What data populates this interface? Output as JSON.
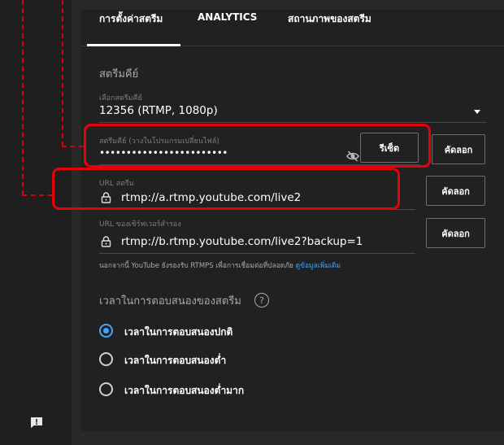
{
  "colors": {
    "accent": "#3ea6ff",
    "highlight": "#e8000b",
    "background": "#212121"
  },
  "tabs": [
    {
      "label": "การตั้งค่าสตรีม",
      "active": true
    },
    {
      "label": "ANALYTICS",
      "active": false
    },
    {
      "label": "สถานภาพของสตรีม",
      "active": false
    }
  ],
  "stream_key_section": {
    "title": "สตรีมคีย์",
    "select_label": "เลือกสตรีมคีย์",
    "select_value": "12356 (RTMP, 1080p)",
    "key_label": "สตรีมคีย์ (วางในโปรแกรมเปลี่ยนไฟล์)",
    "key_value": "••••••••••••••••••••••••",
    "reset_button": "รีเซ็ต",
    "copy_button": "คัดลอก"
  },
  "stream_url": {
    "label": "URL สตรีม",
    "value": "rtmp://a.rtmp.youtube.com/live2",
    "copy_button": "คัดลอก"
  },
  "backup_url": {
    "label": "URL ของเซิร์ฟเวอร์สำรอง",
    "value": "rtmp://b.rtmp.youtube.com/live2?backup=1",
    "copy_button": "คัดลอก"
  },
  "note": {
    "text": "นอกจากนี้ YouTube ยังรองรับ RTMPS เพื่อการเชื่อมต่อที่ปลอดภัย",
    "link": "ดูข้อมูลเพิ่มเติม"
  },
  "latency": {
    "title": "เวลาในการตอบสนองของสตรีม",
    "help": "?",
    "options": [
      {
        "label": "เวลาในการตอบสนองปกติ",
        "selected": true
      },
      {
        "label": "เวลาในการตอบสนองต่ำ",
        "selected": false
      },
      {
        "label": "เวลาในการตอบสนองต่ำมาก",
        "selected": false
      }
    ]
  },
  "icons": [
    "lock-icon",
    "eye-off-icon",
    "help-icon",
    "feedback-icon",
    "dropdown-arrow-icon"
  ]
}
